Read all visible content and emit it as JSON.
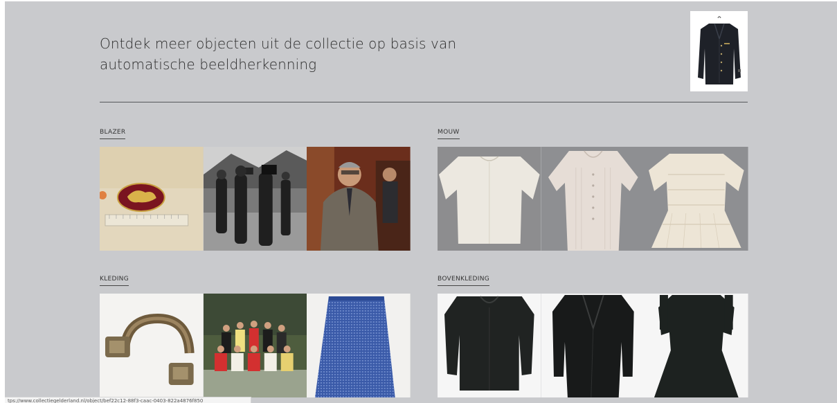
{
  "page": {
    "headline": "Ontdek meer objecten uit de collectie op basis van automatische beeldherkenning",
    "query_image": "jacket-photo"
  },
  "sections": [
    {
      "label": "BLAZER",
      "images": [
        "badge-photo",
        "film-crew-photo",
        "man-in-suit-photo"
      ]
    },
    {
      "label": "MOUW",
      "images": [
        "white-shirt-photo",
        "white-blouse-photo",
        "white-dress-photo"
      ]
    },
    {
      "label": "KLEDING",
      "images": [
        "metal-ring-photo",
        "team-photo",
        "blue-skirt-photo"
      ]
    },
    {
      "label": "BOVENKLEDING",
      "images": [
        "black-jacket-photo",
        "black-tailcoat-photo",
        "black-dress-photo"
      ]
    }
  ],
  "status": {
    "url": "tps://www.collectiegelderland.nl/object/bef22c12-88f3-caac-0403-822a4876f850"
  },
  "colors": {
    "panel": "#c9cacd",
    "text": "#2b2b2b"
  }
}
